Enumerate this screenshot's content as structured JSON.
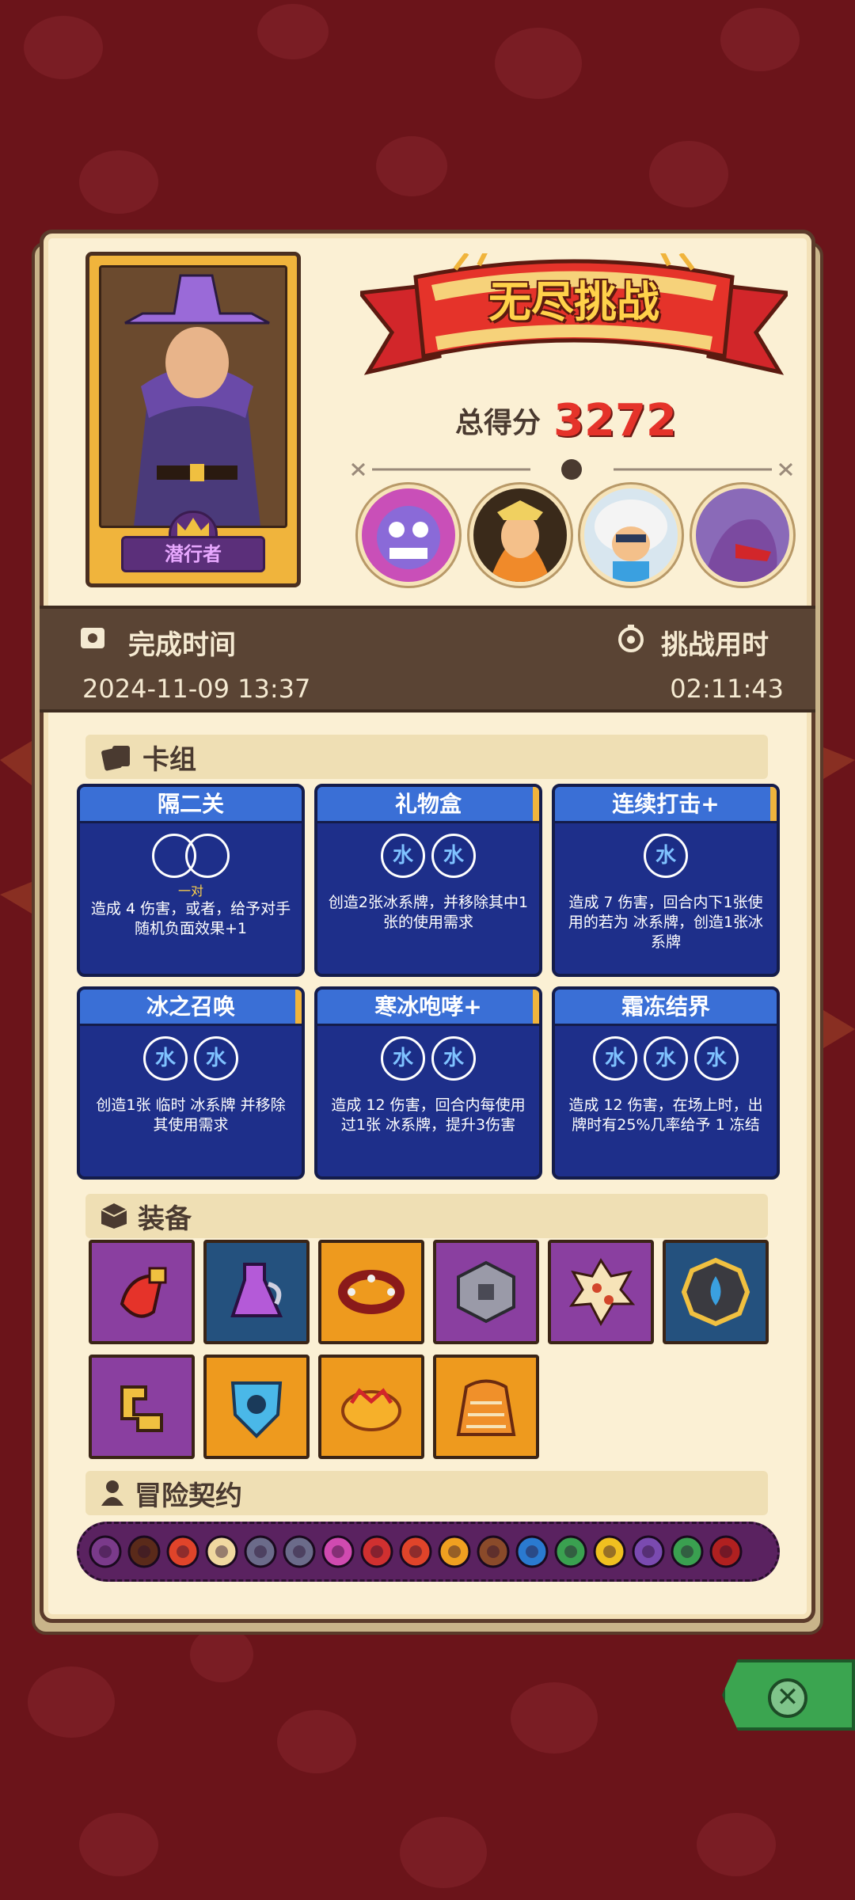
{
  "character": {
    "name": "潜行者"
  },
  "header": {
    "title": "无尽挑战",
    "score_label": "总得分",
    "score_value": "3272"
  },
  "bosses": [
    {
      "name": "boss-1",
      "color": "#c94fb8"
    },
    {
      "name": "boss-2",
      "color": "#f08a2a"
    },
    {
      "name": "boss-3",
      "color": "#3a7fd6"
    },
    {
      "name": "boss-4",
      "color": "#7b4aa0"
    }
  ],
  "time": {
    "completed_label": "完成时间",
    "completed_value": "2024-11-09 13:37",
    "duration_label": "挑战用时",
    "duration_value": "02:11:43"
  },
  "sections": {
    "cards": "卡组",
    "equipment": "装备",
    "contracts": "冒险契约"
  },
  "cards": [
    {
      "title": "隔二关",
      "icons": "pair",
      "sub": "一对",
      "desc": "造成 4 伤害，或者，给予对手随机负面效果+1"
    },
    {
      "title": "礼物盒",
      "icons": "ice2",
      "desc": "创造2张冰系牌，并移除其中1张的使用需求"
    },
    {
      "title": "连续打击+",
      "icons": "ice1",
      "desc": "造成 7 伤害，回合内下1张使用的若为 冰系牌，创造1张冰系牌"
    },
    {
      "title": "冰之召唤",
      "icons": "ice2",
      "desc": "创造1张 临时 冰系牌 并移除其使用需求"
    },
    {
      "title": "寒冰咆哮+",
      "icons": "ice2",
      "desc": "造成 12 伤害，回合内每使用过1张 冰系牌，提升3伤害"
    },
    {
      "title": "霜冻结界",
      "icons": "ice3",
      "desc": "造成 12 伤害，在场上时，出牌时有25%几率给予 1 冻结"
    }
  ],
  "ice_glyph": "水",
  "equipment": [
    {
      "name": "red-flask-icon",
      "bg": "purple"
    },
    {
      "name": "purple-potion-icon",
      "bg": "blue"
    },
    {
      "name": "spiked-collar-icon",
      "bg": "orange"
    },
    {
      "name": "stone-cube-icon",
      "bg": "purple"
    },
    {
      "name": "spotted-dice-icon",
      "bg": "purple"
    },
    {
      "name": "water-amulet-icon",
      "bg": "blue"
    },
    {
      "name": "gold-rune-icon",
      "bg": "purple"
    },
    {
      "name": "ice-shield-icon",
      "bg": "orange"
    },
    {
      "name": "gold-crown-icon",
      "bg": "orange"
    },
    {
      "name": "fur-cloak-icon",
      "bg": "orange"
    }
  ],
  "contracts": [
    "#7a3a8a",
    "#5a2a1a",
    "#e0442a",
    "#f0d8a0",
    "#6b6b8a",
    "#6b6b8a",
    "#d04ab0",
    "#d03030",
    "#e0442a",
    "#f0a020",
    "#8a4a2a",
    "#2a7ad0",
    "#3aa050",
    "#f0c020",
    "#7a4ab0",
    "#3aa050",
    "#b02020"
  ]
}
